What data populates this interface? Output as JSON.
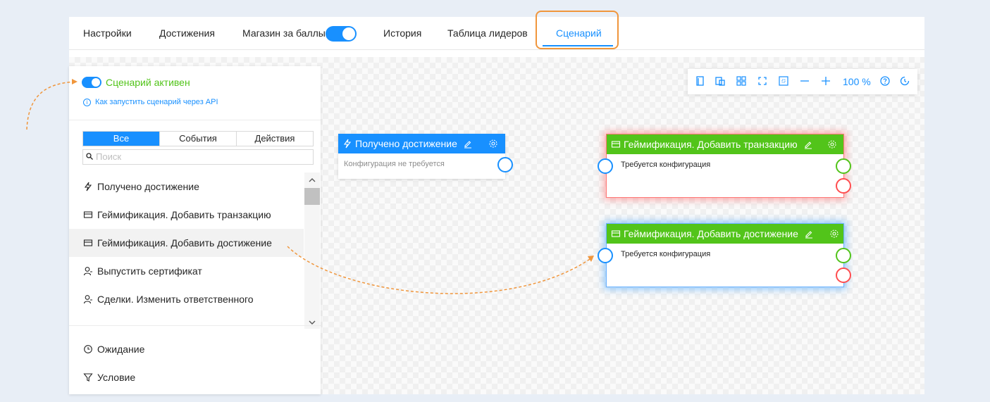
{
  "tabs": [
    {
      "label": "Настройки"
    },
    {
      "label": "Достижения"
    },
    {
      "label": "Магазин за баллы"
    },
    {
      "label": "История"
    },
    {
      "label": "Таблица лидеров"
    },
    {
      "label": "Сценарий"
    }
  ],
  "shop_toggle_on": true,
  "active_tab": "Сценарий",
  "panel": {
    "scenario_active_label": "Сценарий активен",
    "api_link": "Как запустить сценарий через API",
    "filters": [
      "Все",
      "События",
      "Действия"
    ],
    "selected_filter": "Все",
    "search_placeholder": "Поиск",
    "items": [
      {
        "label": "Получено достижение",
        "icon": "lightning-icon"
      },
      {
        "label": "Геймификация. Добавить транзакцию",
        "icon": "card-icon"
      },
      {
        "label": "Геймификация. Добавить достижение",
        "icon": "card-icon"
      },
      {
        "label": "Выпустить сертификат",
        "icon": "user-icon"
      },
      {
        "label": "Сделки. Изменить ответственного",
        "icon": "user-icon"
      }
    ],
    "bottom_items": [
      {
        "label": "Ожидание",
        "icon": "clock-icon"
      },
      {
        "label": "Условие",
        "icon": "filter-icon"
      }
    ]
  },
  "toolbar": {
    "zoom": "100 %"
  },
  "nodes": {
    "trigger": {
      "title": "Получено достижение",
      "body": "Конфигурация не требуется"
    },
    "transaction": {
      "title": "Геймификация. Добавить транзакцию",
      "body": "Требуется конфигурация"
    },
    "achievement": {
      "title": "Геймификация. Добавить достижение",
      "body": "Требуется конфигурация"
    }
  },
  "colors": {
    "accent": "#1890ff",
    "success": "#52c41a",
    "error": "#ff4d4f",
    "highlight": "#f0963c"
  }
}
